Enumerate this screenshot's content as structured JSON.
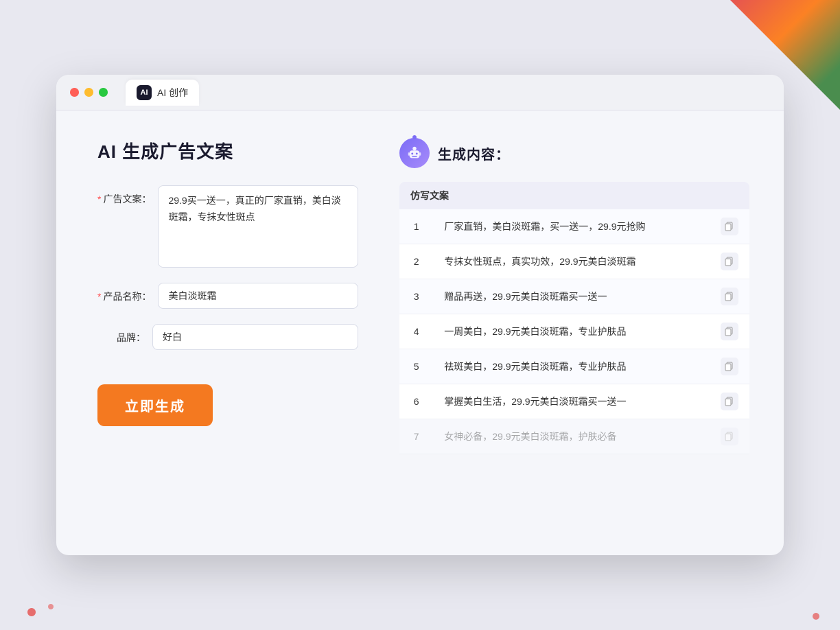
{
  "window": {
    "tab_icon_text": "AI",
    "tab_title": "AI 创作"
  },
  "left_panel": {
    "page_title": "AI 生成广告文案",
    "form": {
      "ad_copy_label": "广告文案：",
      "ad_copy_required": true,
      "ad_copy_value": "29.9买一送一，真正的厂家直销，美白淡斑霜，专抹女性斑点",
      "product_name_label": "产品名称：",
      "product_name_required": true,
      "product_name_value": "美白淡斑霜",
      "brand_label": "品牌：",
      "brand_required": false,
      "brand_value": "好白"
    },
    "generate_button_label": "立即生成"
  },
  "right_panel": {
    "title": "生成内容：",
    "table_header": "仿写文案",
    "results": [
      {
        "num": "1",
        "text": "厂家直销，美白淡斑霜，买一送一，29.9元抢购"
      },
      {
        "num": "2",
        "text": "专抹女性斑点，真实功效，29.9元美白淡斑霜"
      },
      {
        "num": "3",
        "text": "赠品再送，29.9元美白淡斑霜买一送一"
      },
      {
        "num": "4",
        "text": "一周美白，29.9元美白淡斑霜，专业护肤品"
      },
      {
        "num": "5",
        "text": "祛斑美白，29.9元美白淡斑霜，专业护肤品"
      },
      {
        "num": "6",
        "text": "掌握美白生活，29.9元美白淡斑霜买一送一"
      },
      {
        "num": "7",
        "text": "女神必备，29.9元美白淡斑霜，护肤必备",
        "faded": true
      }
    ]
  },
  "colors": {
    "accent_orange": "#f47920",
    "accent_purple": "#7b6cf6",
    "required_red": "#ff4d4f"
  }
}
